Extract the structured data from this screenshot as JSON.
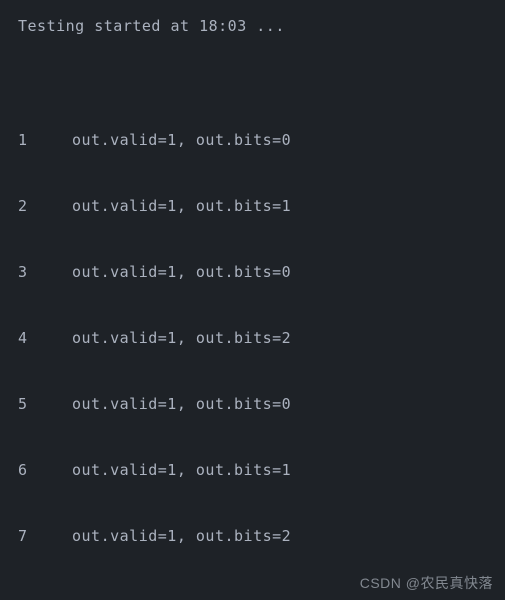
{
  "header": {
    "text": "Testing started at 18:03 ..."
  },
  "output": [
    {
      "num": "1",
      "text": "out.valid=1, out.bits=0"
    },
    {
      "num": "2",
      "text": "out.valid=1, out.bits=1"
    },
    {
      "num": "3",
      "text": "out.valid=1, out.bits=0"
    },
    {
      "num": "4",
      "text": "out.valid=1, out.bits=2"
    },
    {
      "num": "5",
      "text": "out.valid=1, out.bits=0"
    },
    {
      "num": "6",
      "text": "out.valid=1, out.bits=1"
    },
    {
      "num": "7",
      "text": "out.valid=1, out.bits=2"
    }
  ],
  "watermark": {
    "text": "CSDN @农民真快落"
  }
}
